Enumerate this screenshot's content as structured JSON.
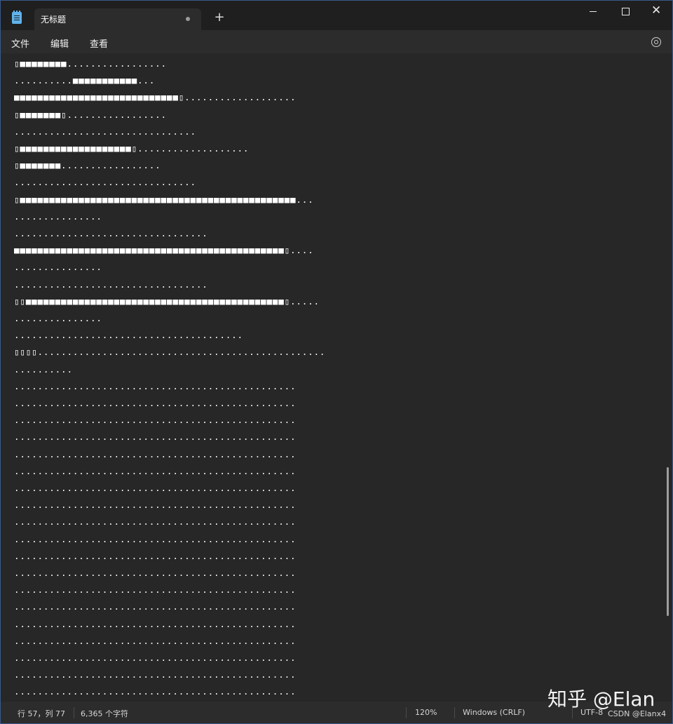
{
  "tab": {
    "title": "无标题"
  },
  "new_tab_label": "+",
  "window_controls": {
    "close_glyph": "✕"
  },
  "menu": {
    "file": "文件",
    "edit": "编辑",
    "view": "查看"
  },
  "editor_lines": [
    "▯■■■■■■■■.................",
    "..........■■■■■■■■■■■...",
    "■■■■■■■■■■■■■■■■■■■■■■■■■■■■▯...................",
    "▯■■■■■■■▯.................",
    "...............................",
    "▯■■■■■■■■■■■■■■■■■■■▯...................",
    "▯■■■■■■■.................",
    "...............................",
    "▯■■■■■■■■■■■■■■■■■■■■■■■■■■■■■■■■■■■■■■■■■■■■■■■...",
    "...............",
    ".................................",
    "■■■■■■■■■■■■■■■■■■■■■■■■■■■■■■■■■■■■■■■■■■■■■■▯....",
    "...............",
    ".................................",
    "▯▯■■■■■■■■■■■■■■■■■■■■■■■■■■■■■■■■■■■■■■■■■■■■▯.....",
    "...............",
    ".......................................",
    "▯▯▯▯.................................................",
    "..........",
    "................................................",
    "................................................",
    "................................................",
    "................................................",
    "................................................",
    "................................................",
    "................................................",
    "................................................",
    "................................................",
    "................................................",
    "................................................",
    "................................................",
    "................................................",
    "................................................",
    "................................................",
    "................................................",
    "................................................",
    "................................................",
    "................................................",
    "................................................",
    "................................................",
    "................................................",
    "................................................",
    "................................................"
  ],
  "status": {
    "position": "行 57，列 77",
    "char_count": "6,365 个字符",
    "zoom": "120%",
    "line_ending": "Windows (CRLF)",
    "encoding": "UTF-8"
  },
  "watermarks": {
    "zhihu": "知乎 @Elan",
    "csdn": "CSDN @Elanx4"
  }
}
